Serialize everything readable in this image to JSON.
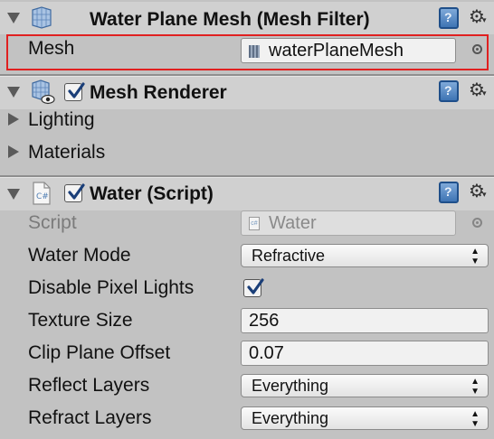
{
  "mesh_filter": {
    "title": "Water Plane Mesh (Mesh Filter)",
    "mesh_label": "Mesh",
    "mesh_value": "waterPlaneMesh"
  },
  "mesh_renderer": {
    "title": "Mesh Renderer",
    "enabled": true,
    "lighting_label": "Lighting",
    "materials_label": "Materials"
  },
  "water_script": {
    "title": "Water (Script)",
    "enabled": true,
    "script_label": "Script",
    "script_value": "Water",
    "water_mode_label": "Water Mode",
    "water_mode_value": "Refractive",
    "disable_pixel_lights_label": "Disable Pixel Lights",
    "disable_pixel_lights_checked": true,
    "texture_size_label": "Texture Size",
    "texture_size_value": "256",
    "clip_plane_offset_label": "Clip Plane Offset",
    "clip_plane_offset_value": "0.07",
    "reflect_layers_label": "Reflect Layers",
    "reflect_layers_value": "Everything",
    "refract_layers_label": "Refract Layers",
    "refract_layers_value": "Everything"
  },
  "icons": {
    "help": "?",
    "gear": "⚙",
    "dropdown_arrows": "▴▾"
  },
  "colors": {
    "highlight_border": "#e02020",
    "panel_bg": "#c2c2c2",
    "header_bg": "#d0d0d0"
  }
}
